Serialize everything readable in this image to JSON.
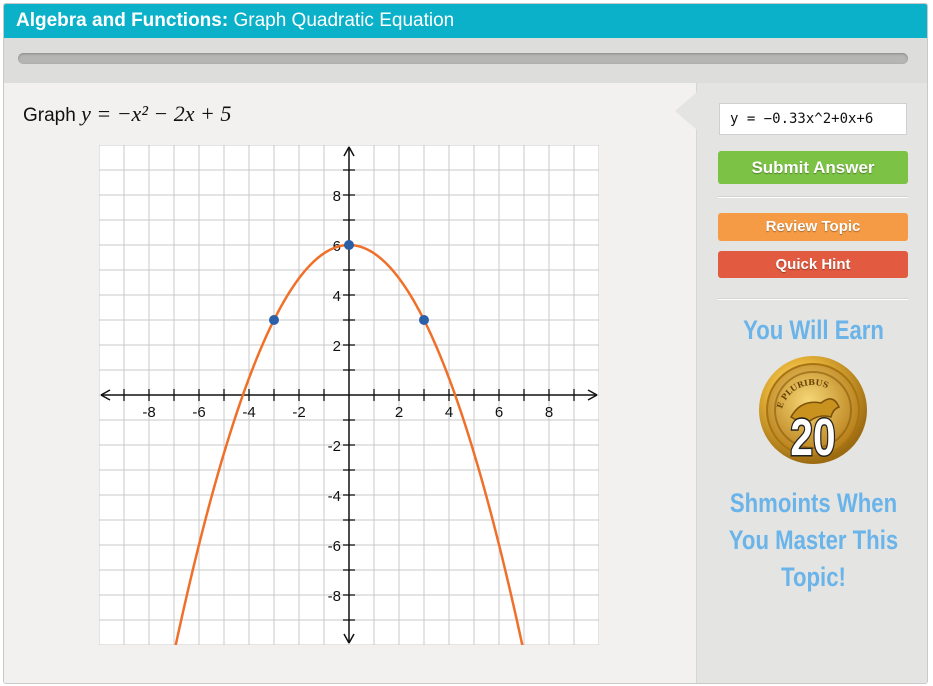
{
  "header": {
    "title_bold": "Algebra and Functions:",
    "title_rest": "Graph Quadratic Equation"
  },
  "progress": {
    "fraction": 0.0
  },
  "question": {
    "lead": "Graph",
    "equation": "y = −x² − 2x + 5"
  },
  "answer": {
    "value": "y = −0.33x^2+0x+6"
  },
  "buttons": {
    "submit": "Submit Answer",
    "review": "Review Topic",
    "hint": "Quick Hint"
  },
  "reward": {
    "top": "You Will Earn",
    "amount": "20",
    "coin_text": "E PLURIBUS",
    "line1": "Shmoints When",
    "line2": "You Master This",
    "line3": "Topic!"
  },
  "colors": {
    "header": "#0ab1c9",
    "submit": "#7cc245",
    "review": "#f59b45",
    "hint": "#e25a3f",
    "curve": "#f0702a",
    "point": "#2b5fa8",
    "reward_text": "#6ab4ea"
  },
  "chart_data": {
    "type": "line",
    "xlim": [
      -10,
      10
    ],
    "ylim": [
      -10,
      10
    ],
    "grid": true,
    "x_ticks": [
      "-8",
      "-6",
      "-4",
      "-2",
      "2",
      "4",
      "6",
      "8"
    ],
    "y_ticks": [
      "8",
      "6",
      "4",
      "2",
      "-2",
      "-4",
      "-6",
      "-8"
    ],
    "curve": {
      "a": -0.333,
      "b": 0,
      "c": 6
    },
    "points": [
      {
        "x": -3,
        "y": 3
      },
      {
        "x": 0,
        "y": 6
      },
      {
        "x": 3,
        "y": 3
      }
    ]
  }
}
